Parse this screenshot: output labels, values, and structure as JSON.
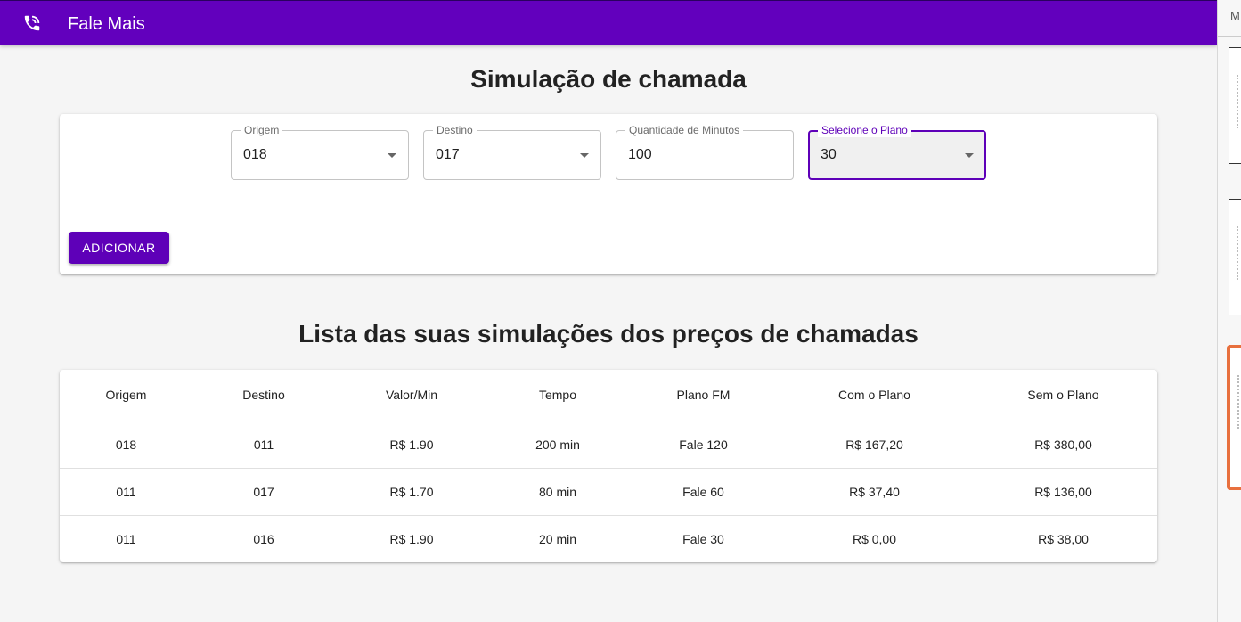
{
  "app": {
    "title": "Fale Mais"
  },
  "form": {
    "heading": "Simulação de chamada",
    "fields": [
      {
        "label": "Origem",
        "value": "018"
      },
      {
        "label": "Destino",
        "value": "017"
      },
      {
        "label": "Quantidade de Minutos",
        "value": "100"
      },
      {
        "label": "Selecione o Plano",
        "value": "30"
      }
    ],
    "add_button": "Adicionar"
  },
  "list": {
    "heading": "Lista das suas simulações dos preços de chamadas",
    "columns": [
      "Origem",
      "Destino",
      "Valor/Min",
      "Tempo",
      "Plano FM",
      "Com o Plano",
      "Sem o Plano"
    ],
    "rows": [
      [
        "018",
        "011",
        "R$ 1.90",
        "200 min",
        "Fale 120",
        "R$ 167,20",
        "R$ 380,00"
      ],
      [
        "011",
        "017",
        "R$ 1.70",
        "80 min",
        "Fale 60",
        "R$ 37,40",
        "R$ 136,00"
      ],
      [
        "011",
        "016",
        "R$ 1.90",
        "20 min",
        "Fale 30",
        "R$ 0,00",
        "R$ 38,00"
      ]
    ]
  },
  "side_panel": {
    "label": "M"
  },
  "colors": {
    "primary": "#6200bd",
    "accent": "#5e00b8",
    "highlight": "#e8703e"
  }
}
